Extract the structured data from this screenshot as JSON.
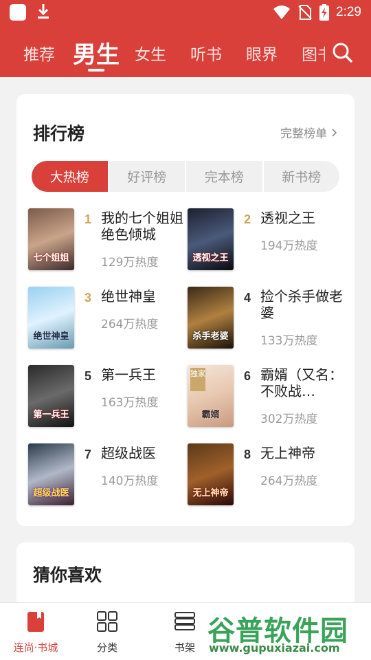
{
  "status_bar": {
    "time": "2:29"
  },
  "nav": {
    "tabs": [
      "推荐",
      "男生",
      "女生",
      "听书",
      "眼界",
      "图书"
    ],
    "active": "男生"
  },
  "ranking": {
    "title": "排行榜",
    "full_list": "完整榜单",
    "segments": [
      "大热榜",
      "好评榜",
      "完本榜",
      "新书榜"
    ],
    "active_segment": "大热榜",
    "books": [
      {
        "rank": "1",
        "title": "我的七个姐姐绝色倾城",
        "heat": "129万热度",
        "cover_text": "七个姐姐"
      },
      {
        "rank": "2",
        "title": "透视之王",
        "heat": "194万热度",
        "cover_text": "透视之王"
      },
      {
        "rank": "3",
        "title": "绝世神皇",
        "heat": "264万热度",
        "cover_text": "绝世神皇"
      },
      {
        "rank": "4",
        "title": "捡个杀手做老婆",
        "heat": "133万热度",
        "cover_text": "杀手老婆"
      },
      {
        "rank": "5",
        "title": "第一兵王",
        "heat": "163万热度",
        "cover_text": "第一兵王"
      },
      {
        "rank": "6",
        "title": "霸婿（又名：不败战…",
        "heat": "302万热度",
        "cover_text": "霸婿",
        "badge": "独家"
      },
      {
        "rank": "7",
        "title": "超级战医",
        "heat": "140万热度",
        "cover_text": "超级战医"
      },
      {
        "rank": "8",
        "title": "无上神帝",
        "heat": "264万热度",
        "cover_text": "无上神帝"
      }
    ]
  },
  "guess": {
    "title": "猜你喜欢"
  },
  "bottom_nav": [
    {
      "label": "连尚·书城",
      "icon": "bookstore-icon"
    },
    {
      "label": "分类",
      "icon": "grid-icon"
    },
    {
      "label": "书架",
      "icon": "bookshelf-icon"
    }
  ],
  "watermark": {
    "text": "谷普软件园",
    "url": "www.gupuxiazai.com"
  },
  "colors": {
    "accent": "#d9403a",
    "rank_top3": "#d4a25a"
  }
}
